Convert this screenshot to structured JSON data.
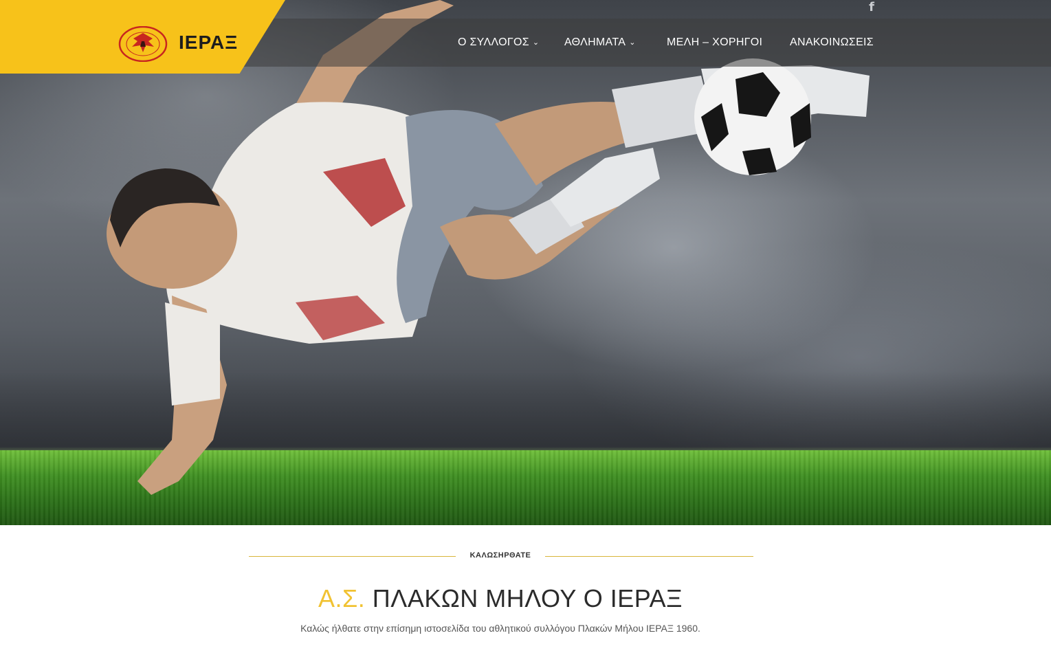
{
  "brand": {
    "name": "ΙΕΡΑΞ",
    "crest_text_top": "Α.Σ. ΠΛΑΚΩΝ ΜΗΛΟΥ \"Ο ΙΕΡΑΞ\"",
    "crest_year": "1960",
    "accent_color": "#f7c21a"
  },
  "social": {
    "facebook_icon": "facebook-icon"
  },
  "nav": {
    "items": [
      {
        "label": "Ο ΣΥΛΛΟΓΟΣ",
        "has_dropdown": true
      },
      {
        "label": "ΑΘΛΗΜΑΤΑ",
        "has_dropdown": true
      },
      {
        "label": "ΜΕΛΗ – ΧΟΡΗΓΟΙ",
        "has_dropdown": false
      },
      {
        "label": "ΑΝΑΚΟΙΝΩΣΕΙΣ",
        "has_dropdown": false
      }
    ]
  },
  "welcome": {
    "eyebrow": "ΚΑΛΩΣΗΡΘΑΤΕ",
    "title_accent": "Α.Σ.",
    "title_main": "ΠΛΑΚΩΝ ΜΗΛΟΥ Ο ΙΕΡΑΞ",
    "subtitle": "Καλώς ήλθατε στην επίσημη ιστοσελίδα του αθλητικού συλλόγου Πλακών Μήλου ΙΕΡΑΞ 1960."
  }
}
